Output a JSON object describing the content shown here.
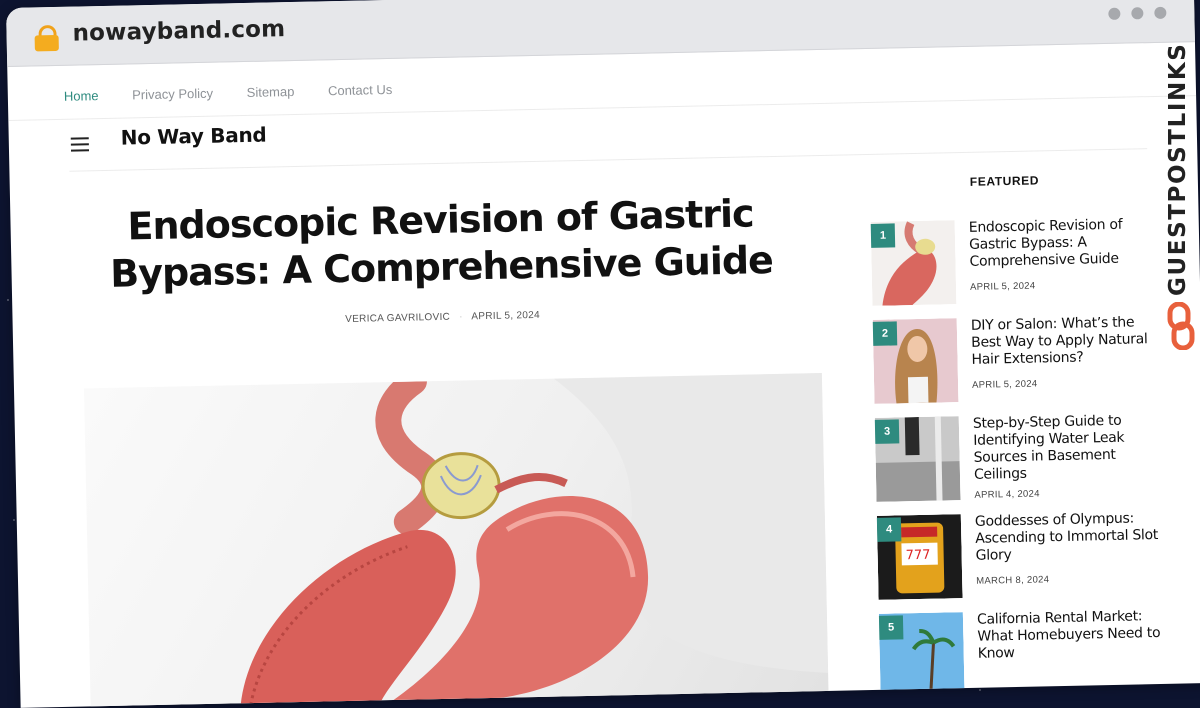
{
  "browser": {
    "url": "nowayband.com"
  },
  "nav": {
    "items": [
      {
        "label": "Home",
        "active": true
      },
      {
        "label": "Privacy Policy",
        "active": false
      },
      {
        "label": "Sitemap",
        "active": false
      },
      {
        "label": "Contact Us",
        "active": false
      }
    ]
  },
  "site": {
    "name": "No Way Band"
  },
  "article": {
    "title": "Endoscopic Revision of Gastric Bypass: A Comprehensive Guide",
    "author": "VERICA GAVRILOVIC",
    "date": "APRIL 5, 2024"
  },
  "featured": {
    "heading": "FEATURED",
    "items": [
      {
        "num": "1",
        "title": "Endoscopic Revision of Gastric Bypass: A Comprehensive Guide",
        "date": "APRIL 5, 2024"
      },
      {
        "num": "2",
        "title": "DIY or Salon: What’s the Best Way to Apply Natural Hair Extensions?",
        "date": "APRIL 5, 2024"
      },
      {
        "num": "3",
        "title": "Step-by-Step Guide to Identifying Water Leak Sources in Basement Ceilings",
        "date": "APRIL 4, 2024"
      },
      {
        "num": "4",
        "title": "Goddesses of Olympus: Ascending to Immortal Slot Glory",
        "date": "MARCH 8, 2024"
      },
      {
        "num": "5",
        "title": "California Rental Market: What Homebuyers Need to Know",
        "date": ""
      }
    ]
  },
  "watermark": {
    "text": "GUESTPOSTLINKS"
  },
  "colors": {
    "accent": "#2e8b7f",
    "lock": "#f4ac1f",
    "watermark_logo": "#e8603c"
  },
  "icons": [
    "lock-icon",
    "menu-icon",
    "window-dots-icon",
    "chain-link-icon"
  ]
}
